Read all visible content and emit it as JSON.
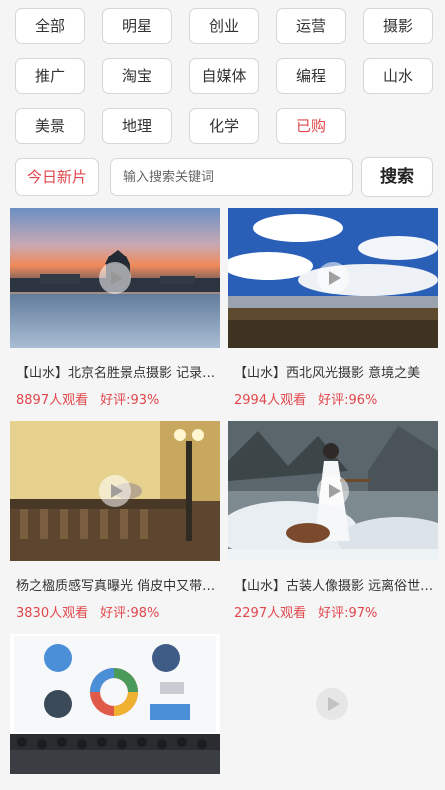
{
  "categories": [
    "全部",
    "明星",
    "创业",
    "运营",
    "摄影",
    "推广",
    "淘宝",
    "自媒体",
    "编程",
    "山水",
    "美景",
    "地理",
    "化学",
    "已购"
  ],
  "today_button": "今日新片",
  "search": {
    "placeholder": "输入搜索关键词",
    "button": "搜索"
  },
  "videos": [
    {
      "title": "【山水】北京名胜景点摄影 记录美丽北京",
      "views": "8897人观看",
      "rating": "好评:93%"
    },
    {
      "title": "【山水】西北风光摄影 意境之美",
      "views": "2994人观看",
      "rating": "好评:96%"
    },
    {
      "title": "杨之楹质感写真曝光 俏皮中又带性感",
      "views": "3830人观看",
      "rating": "好评:98%"
    },
    {
      "title": "【山水】古装人像摄影 远离俗世之美",
      "views": "2297人观看",
      "rating": "好评:97%"
    },
    {
      "title": "",
      "views": "",
      "rating": ""
    }
  ]
}
